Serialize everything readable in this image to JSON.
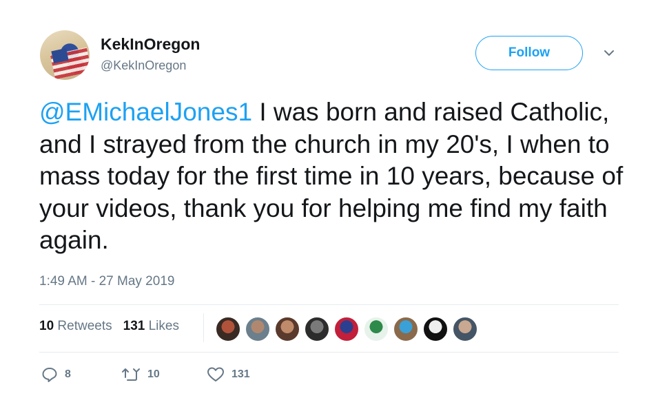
{
  "user": {
    "name": "KekInOregon",
    "handle": "@KekInOregon",
    "follow_label": "Follow"
  },
  "tweet": {
    "mention": "@EMichaelJones1",
    "body": " I was born and raised Catholic, and I strayed from the church in my 20's, I when to mass today for the first time in 10 years, because of your videos, thank you for helping me find my faith again.",
    "timestamp": "1:49 AM - 27 May 2019"
  },
  "stats": {
    "retweets_count": "10",
    "retweets_label": "Retweets",
    "likes_count": "131",
    "likes_label": "Likes"
  },
  "liker_avatars": [
    {
      "colors": [
        "#3a2a24",
        "#b0533a"
      ]
    },
    {
      "colors": [
        "#6b7f8c",
        "#b08870"
      ]
    },
    {
      "colors": [
        "#5a3a2c",
        "#c08b6a"
      ]
    },
    {
      "colors": [
        "#2c2c2c",
        "#7a7a7a"
      ]
    },
    {
      "colors": [
        "#c21f3a",
        "#2a3f8f"
      ]
    },
    {
      "colors": [
        "#e7f2ea",
        "#2e8a4a"
      ]
    },
    {
      "colors": [
        "#8a6a4a",
        "#3aa0d8"
      ]
    },
    {
      "colors": [
        "#111111",
        "#eeeeee"
      ]
    },
    {
      "colors": [
        "#445566",
        "#c8a890"
      ]
    }
  ],
  "actions": {
    "reply_count": "8",
    "retweet_count": "10",
    "like_count": "131"
  },
  "colors": {
    "accent": "#1da1f2",
    "text": "#14171a",
    "muted": "#657786",
    "divider": "#e6ecf0"
  }
}
